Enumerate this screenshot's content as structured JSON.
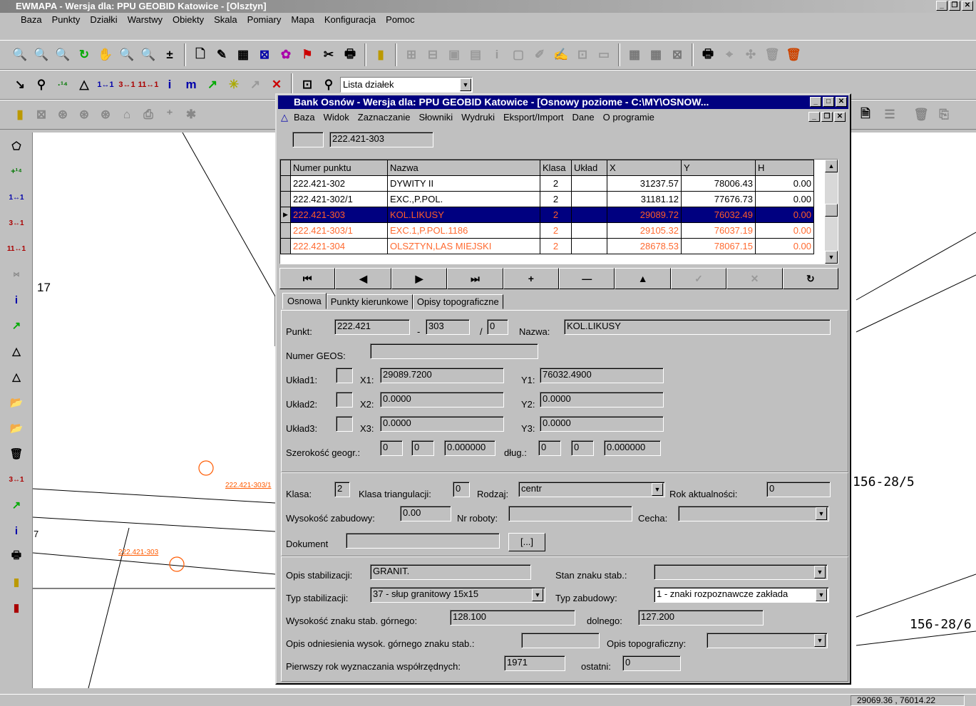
{
  "app": {
    "title": "EWMAPA - Wersja dla: PPU GEOBID Katowice - [Olsztyn]",
    "menu": [
      "Baza",
      "Punkty",
      "Działki",
      "Warstwy",
      "Obiekty",
      "Skala",
      "Pomiary",
      "Mapa",
      "Konfiguracja",
      "Pomoc"
    ]
  },
  "toolbar2": {
    "layer_select": "Lista działek"
  },
  "map": {
    "label_1": "17",
    "label_2": "7",
    "parcel_1": "156-28/5",
    "parcel_2": "156-28/6",
    "point_1": "222.421-303/1",
    "point_2": "222.421-303"
  },
  "status": {
    "coords": "29069.36 , 76014.22"
  },
  "dialog": {
    "title": "Bank Osnów - Wersja dla: PPU GEOBID Katowice - [Osnowy poziome - C:\\MY\\OSNOW...",
    "menu": [
      "Baza",
      "Widok",
      "Zaznaczanie",
      "Słowniki",
      "Wydruki",
      "Eksport/Import",
      "Dane",
      "O programie"
    ],
    "search_value": "222.421-303",
    "columns": [
      "Numer punktu",
      "Nazwa",
      "Klasa",
      "Układ",
      "X",
      "Y",
      "H"
    ],
    "rows": [
      [
        "222.421-302",
        "DYWITY II",
        "2",
        "",
        "31237.57",
        "78006.43",
        "0.00"
      ],
      [
        "222.421-302/1",
        "EXC.,P.POL.",
        "2",
        "",
        "31181.12",
        "77676.73",
        "0.00"
      ],
      [
        "222.421-303",
        "KOL.LIKUSY",
        "2",
        "",
        "29089.72",
        "76032.49",
        "0.00"
      ],
      [
        "222.421-303/1",
        "EXC.1,P.POL.1186",
        "2",
        "",
        "29105.32",
        "76037.19",
        "0.00"
      ],
      [
        "222.421-304",
        "OLSZTYN,LAS MIEJSKI",
        "2",
        "",
        "28678.53",
        "78067.15",
        "0.00"
      ]
    ],
    "tabs": [
      "Osnowa",
      "Punkty kierunkowe",
      "Opisy topograficzne"
    ],
    "form": {
      "punkt_label": "Punkt:",
      "punkt_a": "222.421",
      "punkt_b": "303",
      "punkt_c": "0",
      "nazwa_label": "Nazwa:",
      "nazwa": "KOL.LIKUSY",
      "geos_label": "Numer GEOS:",
      "geos": "",
      "uklad1_label": "Układ1:",
      "x1_label": "X1:",
      "x1": "29089.7200",
      "y1_label": "Y1:",
      "y1": "76032.4900",
      "uklad2_label": "Układ2:",
      "x2_label": "X2:",
      "x2": "0.0000",
      "y2_label": "Y2:",
      "y2": "0.0000",
      "uklad3_label": "Układ3:",
      "x3_label": "X3:",
      "x3": "0.0000",
      "y3_label": "Y3:",
      "y3": "0.0000",
      "szer_label": "Szerokość geogr.:",
      "szer_d": "0",
      "szer_m": "0",
      "szer_s": "0.000000",
      "dl_label": "dług.:",
      "dl_d": "0",
      "dl_m": "0",
      "dl_s": "0.000000",
      "klasa_label": "Klasa:",
      "klasa": "2",
      "klasa_tri_label": "Klasa triangulacji:",
      "klasa_tri": "0",
      "rodzaj_label": "Rodzaj:",
      "rodzaj": "centr",
      "rok_label": "Rok aktualności:",
      "rok": "0",
      "wys_zab_label": "Wysokość zabudowy:",
      "wys_zab": "0.00",
      "nr_rob_label": "Nr roboty:",
      "nr_rob": "",
      "cecha_label": "Cecha:",
      "cecha": "",
      "dok_label": "Dokument",
      "dok": "",
      "dok_btn": "[...]",
      "opis_stab_label": "Opis stabilizacji:",
      "opis_stab": "GRANIT.",
      "stan_label": "Stan znaku stab.:",
      "stan": "",
      "typ_stab_label": "Typ stabilizacji:",
      "typ_stab": "37 - słup granitowy 15x15",
      "typ_zab_label": "Typ zabudowy:",
      "typ_zab": "1 - znaki rozpoznawcze zakłada",
      "wys_gorny_label": "Wysokość znaku stab. górnego:",
      "wys_gorny": "128.100",
      "dolnego_label": "dolnego:",
      "dolnego": "127.200",
      "opis_odn_label": "Opis odniesienia wysok. górnego znaku stab.:",
      "opis_odn": "",
      "opis_topo_label": "Opis topograficzny:",
      "opis_topo": "",
      "pierwszy_label": "Pierwszy rok wyznaczania  współrzędnych:",
      "pierwszy": "1971",
      "ostatni_label": "ostatni:",
      "ostatni": "0"
    }
  }
}
